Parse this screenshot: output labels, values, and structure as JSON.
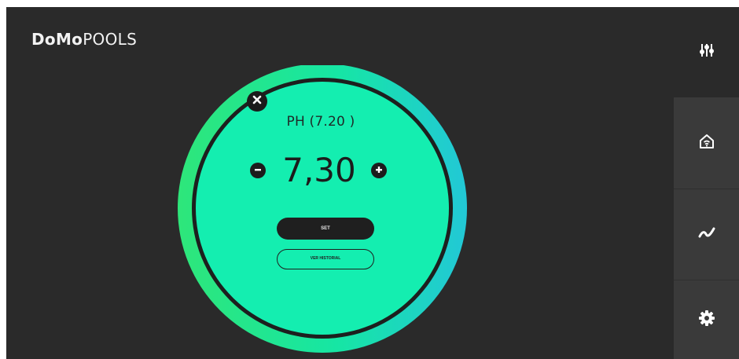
{
  "app": {
    "logo_bold": "DoMo",
    "logo_regular": "POOLS"
  },
  "dial": {
    "label": "PH (7.20 )",
    "value": "7,30",
    "set_label": "SET",
    "history_label": "VER HISTORIAL"
  },
  "sidebar": {
    "items": [
      {
        "icon": "sliders-icon"
      },
      {
        "icon": "home-icon"
      },
      {
        "icon": "trend-icon"
      },
      {
        "icon": "gear-icon"
      }
    ]
  },
  "colors": {
    "background": "#2a2a2a",
    "sidebar_panel": "#3a3a3a",
    "dial_fill": "#14eeb0",
    "ring_green": "#2ee67a",
    "ring_cyan": "#22c8d6"
  }
}
